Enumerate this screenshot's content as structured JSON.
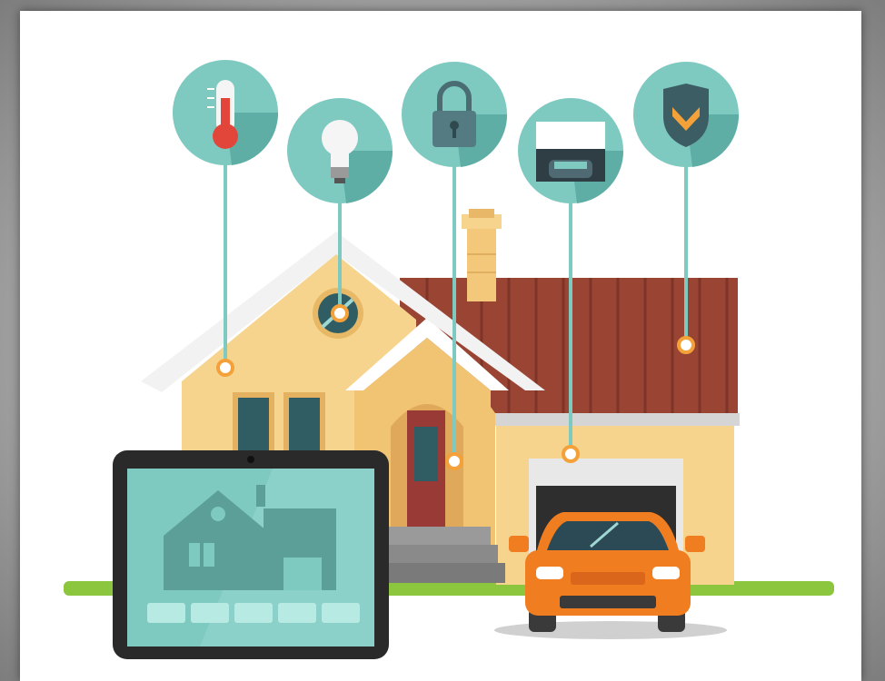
{
  "illustration": {
    "colors": {
      "teal": "#7ec9c0",
      "teal_dark": "#4e9e96",
      "orange_accent": "#f4a13a",
      "house_wall": "#f6d48e",
      "roof_red": "#9a4434",
      "car_orange": "#f07d1f",
      "tablet_frame": "#2a2a2a",
      "ground_green": "#8cc63f"
    },
    "icons": [
      {
        "name": "thermometer-icon"
      },
      {
        "name": "light-bulb-icon"
      },
      {
        "name": "padlock-icon"
      },
      {
        "name": "garage-car-icon"
      },
      {
        "name": "security-shield-icon"
      }
    ],
    "tablet_buttons": 5
  }
}
